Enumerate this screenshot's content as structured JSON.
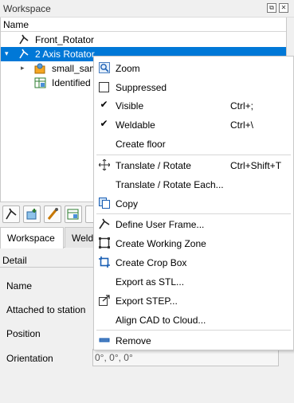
{
  "workspace_panel": {
    "title": "Workspace",
    "column_header": "Name",
    "tree": [
      {
        "label": "Front_Rotator"
      },
      {
        "label": "2 Axis Rotator"
      },
      {
        "label": "small_sam"
      },
      {
        "label": "Identified"
      }
    ]
  },
  "tabs": [
    {
      "label": "Workspace"
    },
    {
      "label": "Weld"
    }
  ],
  "detail": {
    "header": "Detail",
    "properties": [
      {
        "label": "Name"
      },
      {
        "label": "Attached to station"
      },
      {
        "label": "Position"
      },
      {
        "label": "Orientation",
        "value": "0°, 0°, 0°"
      }
    ]
  },
  "context_menu": {
    "items": [
      {
        "label": "Zoom",
        "icon": "zoom-icon"
      },
      {
        "label": "Suppressed",
        "checked": false
      },
      {
        "label": "Visible",
        "checked": true,
        "shortcut": "Ctrl+;"
      },
      {
        "label": "Weldable",
        "checked": true,
        "shortcut": "Ctrl+\\"
      },
      {
        "label": "Create floor"
      },
      {
        "label": "Translate / Rotate",
        "shortcut": "Ctrl+Shift+T",
        "icon": "move-icon"
      },
      {
        "label": "Translate / Rotate Each..."
      },
      {
        "label": "Copy",
        "icon": "copy-icon"
      },
      {
        "label": "Define User Frame...",
        "icon": "frame-icon"
      },
      {
        "label": "Create Working Zone",
        "icon": "working-zone-icon"
      },
      {
        "label": "Create Crop Box",
        "icon": "crop-box-icon"
      },
      {
        "label": "Export as STL..."
      },
      {
        "label": "Export STEP...",
        "icon": "export-step-icon"
      },
      {
        "label": "Align CAD to Cloud..."
      },
      {
        "label": "Remove",
        "icon": "remove-icon"
      }
    ]
  },
  "colors": {
    "selection": "#0078d7",
    "accent": "#1a5fb4"
  }
}
